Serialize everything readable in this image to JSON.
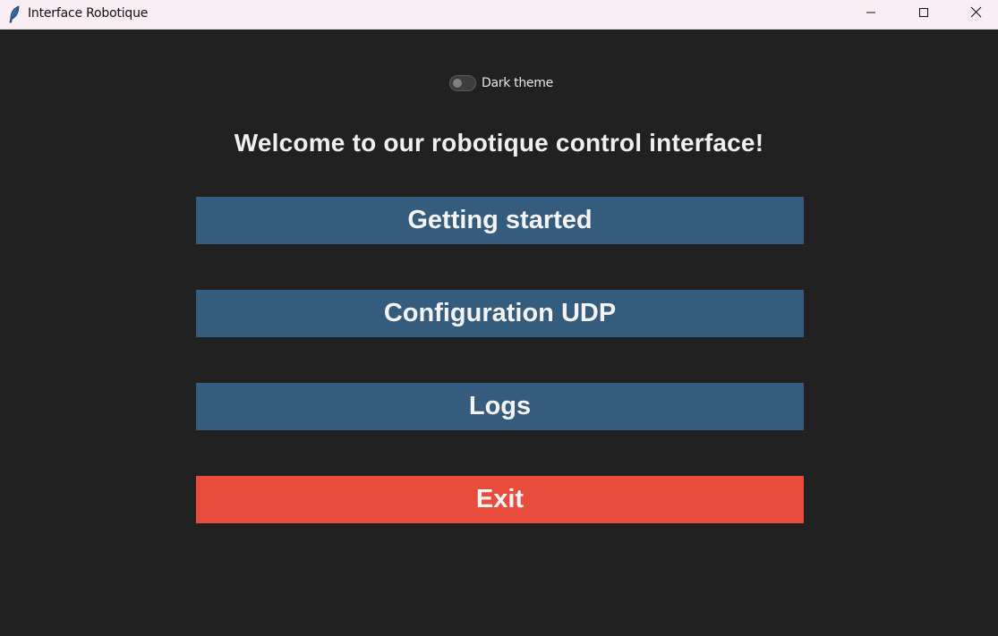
{
  "window": {
    "title": "Interface Robotique",
    "icon": "feather-icon",
    "controls": [
      "minimize-icon",
      "maximize-icon",
      "close-icon"
    ]
  },
  "theme_toggle": {
    "label": "Dark theme",
    "checked": false
  },
  "main": {
    "welcome_text": "Welcome to our robotique control interface!",
    "buttons": [
      {
        "label": "Getting started",
        "color": "#355b7d"
      },
      {
        "label": "Configuration UDP",
        "color": "#355b7d"
      },
      {
        "label": "Logs",
        "color": "#355b7d"
      },
      {
        "label": "Exit",
        "color": "#e74c3c"
      }
    ]
  },
  "colors": {
    "background": "#212121",
    "titlebar": "#f9eef3",
    "primary_button": "#355b7d",
    "exit_button": "#e74c3c",
    "text": "#f4f4f4"
  }
}
